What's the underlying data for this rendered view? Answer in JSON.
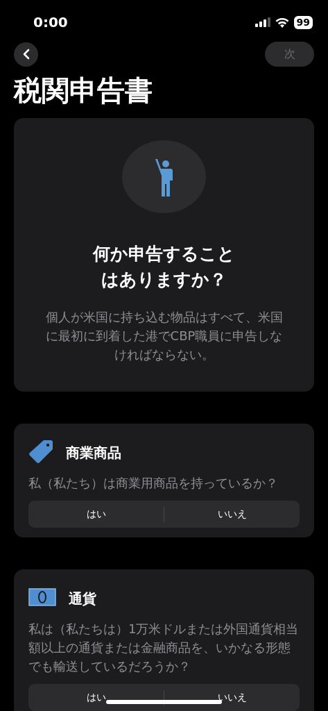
{
  "status_bar": {
    "time": "0:00",
    "battery": "99"
  },
  "nav": {
    "next_button": {
      "label": "次",
      "disabled": true
    }
  },
  "title": "税関申告書",
  "intro": {
    "heading": "何か申告することはありますか？",
    "body": "個人が米国に持ち込む物品はすべて、米国に最初に到着した港でCBP職員に申告しなければならない。"
  },
  "sections": [
    {
      "kind": "tag",
      "title": "商業商品",
      "question": "私（私たち）は商業用商品を持っているか？",
      "options": [
        {
          "label": "はい",
          "selected": false
        },
        {
          "label": "いいえ",
          "selected": false
        }
      ]
    },
    {
      "kind": "currency",
      "title": "通貨",
      "question": "私は（私たちは）1万米ドルまたは外国通貨相当額以上の通貨または金融商品を、いかなる形態でも輸送しているだろうか？",
      "options": [
        {
          "label": "はい",
          "selected": false
        },
        {
          "label": "いいえ",
          "selected": false
        }
      ]
    }
  ]
}
